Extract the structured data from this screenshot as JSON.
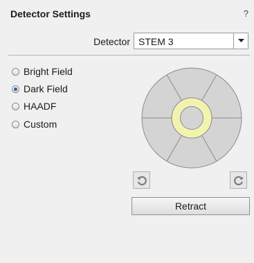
{
  "panel": {
    "title": "Detector Settings",
    "help": "?"
  },
  "detector": {
    "label": "Detector",
    "selected": "STEM 3"
  },
  "modes": [
    {
      "label": "Bright Field",
      "checked": false
    },
    {
      "label": "Dark Field",
      "checked": true
    },
    {
      "label": "HAADF",
      "checked": false
    },
    {
      "label": "Custom",
      "checked": false
    }
  ],
  "diagram": {
    "segment_color": "#d4d4d4",
    "ring_color": "#f3f3b0",
    "ring_border": "#8a8a8a"
  },
  "controls": {
    "rotate_ccw_icon": "rotate-ccw-icon",
    "rotate_cw_icon": "rotate-cw-icon",
    "retract_label": "Retract"
  }
}
